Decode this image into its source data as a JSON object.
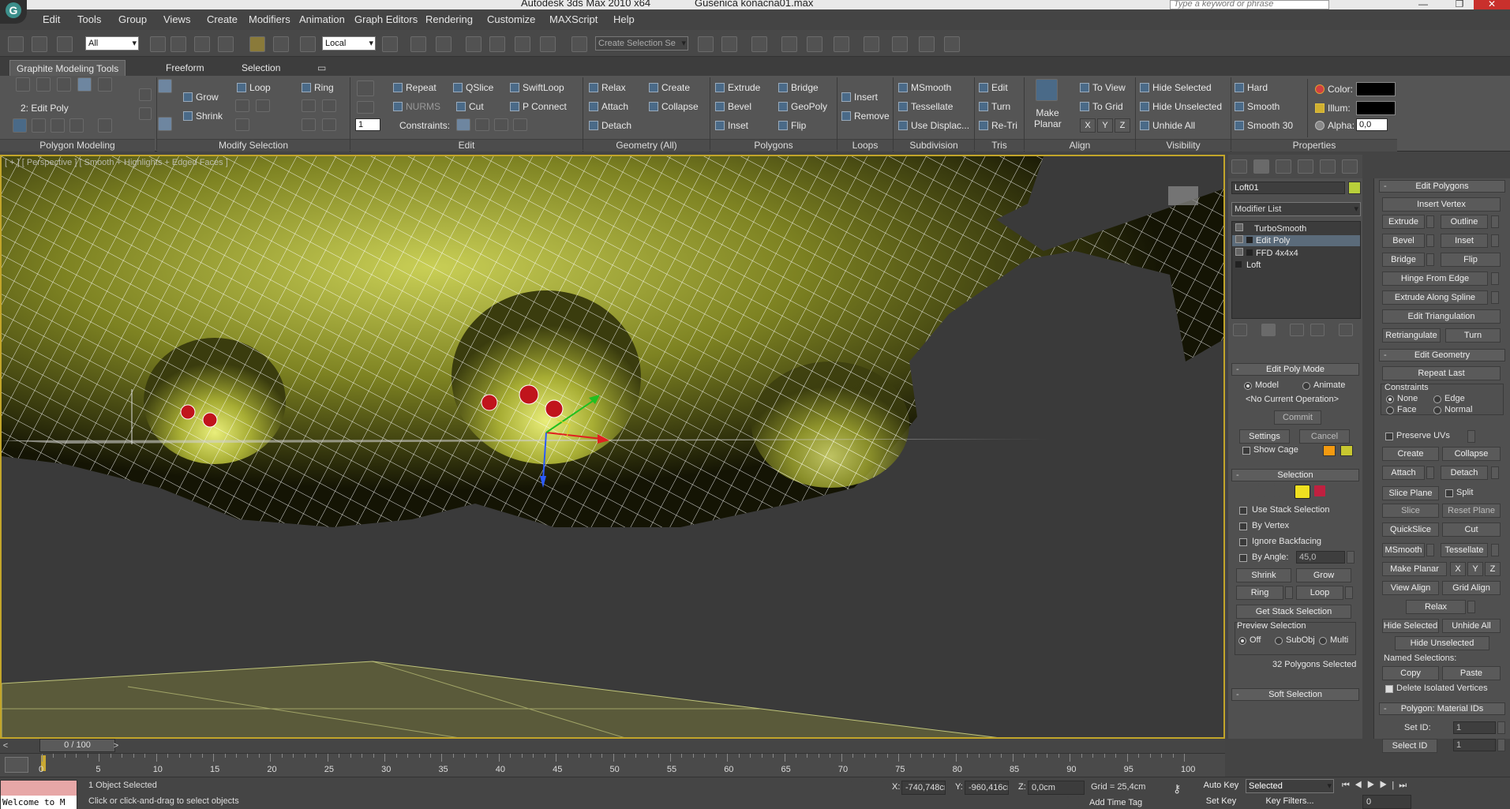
{
  "title": {
    "app": "Autodesk 3ds Max  2010 x64",
    "file": "Gusenica konacna01.max"
  },
  "search": {
    "placeholder": "Type a keyword or phrase"
  },
  "menu": [
    "Edit",
    "Tools",
    "Group",
    "Views",
    "Create",
    "Modifiers",
    "Animation",
    "Graph Editors",
    "Rendering",
    "Customize",
    "MAXScript",
    "Help"
  ],
  "toolbar": {
    "filter": "All",
    "refcoord": "Local",
    "selection_set": "Create Selection Se"
  },
  "ribbon": {
    "tabs": [
      "Graphite Modeling Tools",
      "Freeform",
      "Selection"
    ],
    "stack_label": "2: Edit Poly",
    "modify": {
      "grow": "Grow",
      "shrink": "Shrink",
      "loop": "Loop",
      "ring": "Ring"
    },
    "edit": {
      "repeat": "Repeat",
      "nurms": "NURMS",
      "qslice": "QSlice",
      "cut": "Cut",
      "swiftloop": "SwiftLoop",
      "pconnect": "P Connect",
      "constraints": "Constraints:",
      "spinner": "1"
    },
    "geometry": {
      "relax": "Relax",
      "create": "Create",
      "attach": "Attach",
      "collapse": "Collapse",
      "detach": "Detach"
    },
    "polygons": {
      "extrude": "Extrude",
      "bridge": "Bridge",
      "bevel": "Bevel",
      "geopoly": "GeoPoly",
      "inset": "Inset",
      "flip": "Flip"
    },
    "loops": {
      "insert": "Insert",
      "remove": "Remove"
    },
    "subdivision": {
      "msmooth": "MSmooth",
      "tessellate": "Tessellate",
      "usedisp": "Use Displac..."
    },
    "tris": {
      "edit": "Edit",
      "turn": "Turn",
      "retri": "Re-Tri"
    },
    "align": {
      "makeplanar": "Make Planar",
      "toview": "To View",
      "togrid": "To Grid",
      "x": "X",
      "y": "Y",
      "z": "Z"
    },
    "visibility": {
      "hidesel": "Hide Selected",
      "hideunsel": "Hide Unselected",
      "unhide": "Unhide All"
    },
    "smoothing": {
      "hard": "Hard",
      "smooth": "Smooth",
      "smooth30": "Smooth 30"
    },
    "properties": {
      "color": "Color:",
      "illum": "Illum:",
      "alpha": "Alpha:",
      "alpha_val": "0,0"
    },
    "groups": [
      "Polygon Modeling",
      "Modify Selection",
      "Edit",
      "Geometry (All)",
      "Polygons",
      "Loops",
      "Subdivision",
      "Tris",
      "Align",
      "Visibility",
      "Properties"
    ]
  },
  "viewport": {
    "label": "[ + ] [ Perspective ] [ Smooth + Highlights + Edged Faces ]"
  },
  "command": {
    "object_name": "Loft01",
    "modifier_list": "Modifier List",
    "stack": [
      "TurboSmooth",
      "Edit Poly",
      "FFD 4x4x4",
      "Loft"
    ],
    "editpoly_mode": {
      "title": "Edit Poly Mode",
      "model": "Model",
      "animate": "Animate",
      "current_op": "<No Current Operation>",
      "commit": "Commit",
      "settings": "Settings",
      "cancel": "Cancel",
      "show_cage": "Show Cage"
    },
    "selection": {
      "title": "Selection",
      "use_stack": "Use Stack Selection",
      "by_vertex": "By Vertex",
      "ignore_back": "Ignore Backfacing",
      "by_angle": "By Angle:",
      "angle_val": "45,0",
      "shrink": "Shrink",
      "grow": "Grow",
      "ring": "Ring",
      "loop": "Loop",
      "get_stack": "Get Stack Selection",
      "preview": "Preview Selection",
      "off": "Off",
      "subobj": "SubObj",
      "multi": "Multi",
      "status": "32 Polygons Selected"
    },
    "soft_selection": "Soft Selection"
  },
  "edit_polygons": {
    "title": "Edit Polygons",
    "insert_vertex": "Insert Vertex",
    "extrude": "Extrude",
    "outline": "Outline",
    "bevel": "Bevel",
    "inset": "Inset",
    "bridge": "Bridge",
    "flip": "Flip",
    "hinge": "Hinge From Edge",
    "extrude_spline": "Extrude Along Spline",
    "edit_tri": "Edit Triangulation",
    "retriangulate": "Retriangulate",
    "turn": "Turn"
  },
  "edit_geometry": {
    "title": "Edit Geometry",
    "repeat_last": "Repeat Last",
    "constraints": "Constraints",
    "none": "None",
    "edge": "Edge",
    "face": "Face",
    "normal": "Normal",
    "preserve_uvs": "Preserve UVs",
    "create": "Create",
    "collapse": "Collapse",
    "attach": "Attach",
    "detach": "Detach",
    "slice_plane": "Slice Plane",
    "split": "Split",
    "slice": "Slice",
    "reset_plane": "Reset Plane",
    "quickslice": "QuickSlice",
    "cut": "Cut",
    "msmooth": "MSmooth",
    "tessellate": "Tessellate",
    "make_planar": "Make Planar",
    "x": "X",
    "y": "Y",
    "z": "Z",
    "view_align": "View Align",
    "grid_align": "Grid Align",
    "relax": "Relax",
    "hide_sel": "Hide Selected",
    "unhide_all": "Unhide All",
    "hide_unsel": "Hide Unselected",
    "named_sel": "Named Selections:",
    "copy": "Copy",
    "paste": "Paste",
    "delete_isolated": "Delete Isolated Vertices"
  },
  "material_ids": {
    "title": "Polygon: Material IDs",
    "set_id": "Set ID:",
    "select_id": "Select ID",
    "val": "1"
  },
  "timeline": {
    "slider": "0 / 100",
    "ticks": [
      "0",
      "5",
      "10",
      "15",
      "20",
      "25",
      "30",
      "35",
      "40",
      "45",
      "50",
      "55",
      "60",
      "65",
      "70",
      "75",
      "80",
      "85",
      "90",
      "95",
      "100"
    ]
  },
  "status": {
    "maxscript": "Welcome to M",
    "selected": "1 Object Selected",
    "prompt": "Click or click-and-drag to select objects",
    "x_label": "X:",
    "x_val": "-740,748cr",
    "y_label": "Y:",
    "y_val": "-960,416cr",
    "z_label": "Z:",
    "z_val": "0,0cm",
    "grid": "Grid = 25,4cm",
    "autokey": "Auto Key",
    "setkey": "Set Key",
    "selected_dd": "Selected",
    "keyfilters": "Key Filters...",
    "add_time_tag": "Add Time Tag",
    "frame": "0"
  },
  "colors": {
    "accent": "#c2a52a",
    "mesh": "#b9be4a",
    "selected_poly": "#c0141c"
  }
}
